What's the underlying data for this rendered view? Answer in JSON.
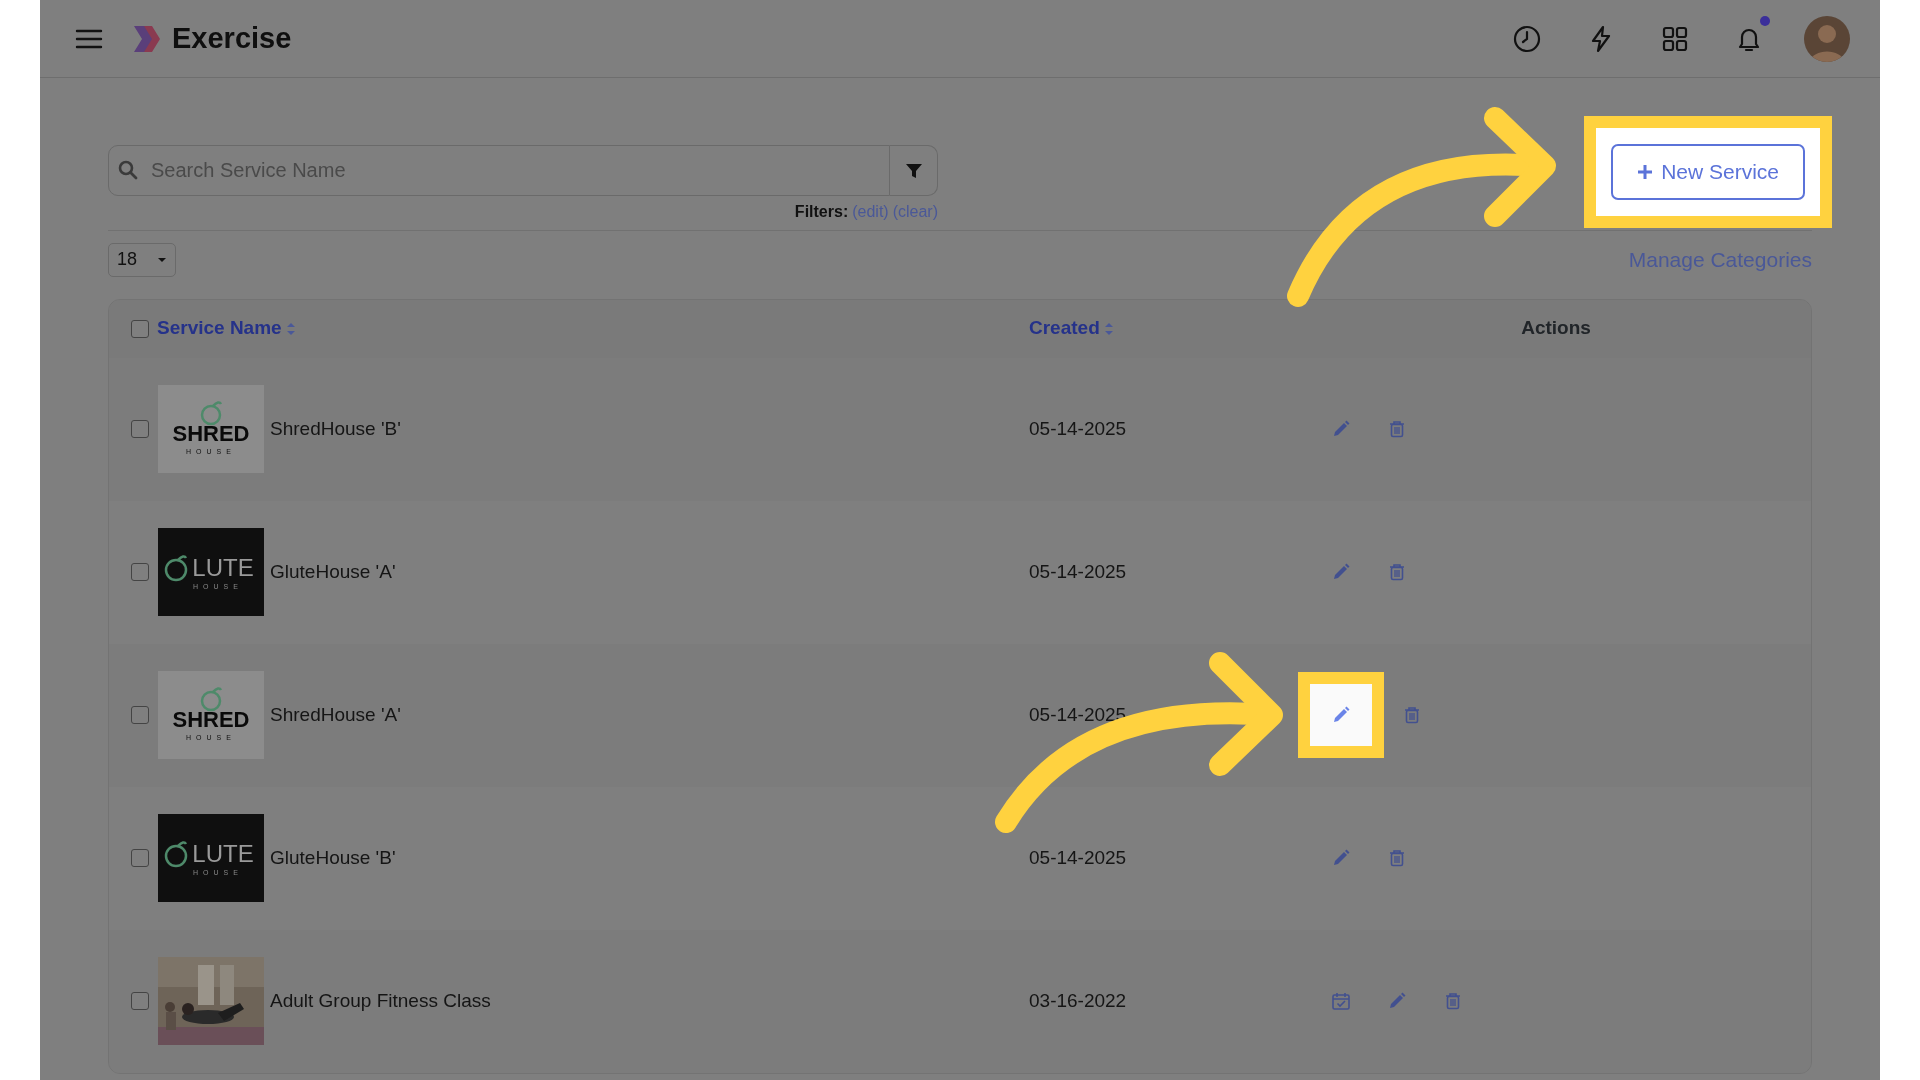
{
  "app_bar": {
    "title": "Exercise",
    "notification_dot": true
  },
  "search": {
    "placeholder": "Search Service Name"
  },
  "filters": {
    "label": "Filters:",
    "edit": "(edit)",
    "clear": "(clear)"
  },
  "new_service_button": {
    "label": "New Service",
    "highlighted": true
  },
  "page_size": "18",
  "manage_categories": "Manage Categories",
  "table": {
    "columns": [
      {
        "label": "Service Name",
        "sortable": true
      },
      {
        "label": "Created",
        "sortable": true
      },
      {
        "label": "Actions",
        "sortable": false
      }
    ],
    "select_all_checked": false,
    "rows": [
      {
        "thumb": {
          "kind": "logo-light",
          "word": "SHRED",
          "sub": "HOUSE"
        },
        "name": "ShredHouse 'B'",
        "created": "05-14-2025",
        "checked": false,
        "actions": [
          {
            "kind": "edit",
            "highlighted": false
          },
          {
            "kind": "delete",
            "highlighted": false
          }
        ]
      },
      {
        "thumb": {
          "kind": "logo-dark",
          "word": "LUTE",
          "sub": "HOUSE"
        },
        "name": "GluteHouse 'A'",
        "created": "05-14-2025",
        "checked": false,
        "actions": [
          {
            "kind": "edit",
            "highlighted": false
          },
          {
            "kind": "delete",
            "highlighted": false
          }
        ]
      },
      {
        "thumb": {
          "kind": "logo-light",
          "word": "SHRED",
          "sub": "HOUSE"
        },
        "name": "ShredHouse 'A'",
        "created": "05-14-2025",
        "checked": false,
        "actions": [
          {
            "kind": "edit",
            "highlighted": true
          },
          {
            "kind": "delete",
            "highlighted": false
          }
        ]
      },
      {
        "thumb": {
          "kind": "logo-dark",
          "word": "LUTE",
          "sub": "HOUSE"
        },
        "name": "GluteHouse 'B'",
        "created": "05-14-2025",
        "checked": false,
        "actions": [
          {
            "kind": "edit",
            "highlighted": false
          },
          {
            "kind": "delete",
            "highlighted": false
          }
        ]
      },
      {
        "name": "Adult Group Fitness Class",
        "created": "03-16-2022",
        "checked": false,
        "actions": [
          {
            "kind": "calendar",
            "highlighted": false
          },
          {
            "kind": "edit",
            "highlighted": false
          },
          {
            "kind": "delete",
            "highlighted": false
          }
        ]
      }
    ]
  }
}
